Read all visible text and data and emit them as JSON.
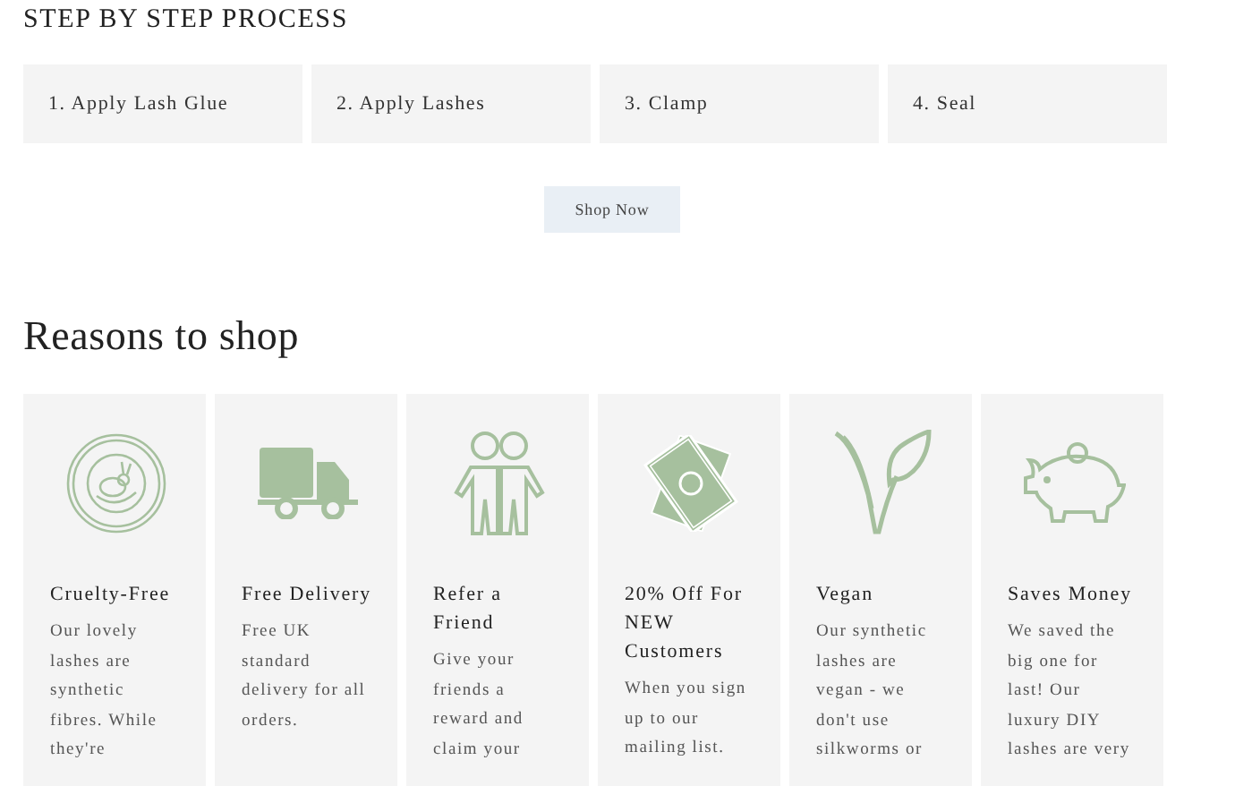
{
  "steps_section": {
    "heading": "STEP BY STEP PROCESS",
    "steps": [
      "1. Apply Lash Glue",
      "2. Apply Lashes",
      "3. Clamp",
      "4. Seal"
    ],
    "button": "Shop Now"
  },
  "reasons_section": {
    "heading": "Reasons to shop",
    "cards": [
      {
        "title_lines": [
          "Cruelty-Free"
        ],
        "body_lines": [
          "Our lovely",
          "lashes are",
          "synthetic",
          "fibres. While",
          "they're"
        ]
      },
      {
        "title_lines": [
          "Free Delivery"
        ],
        "body_lines": [
          "Free UK",
          "standard",
          "delivery for all",
          "orders."
        ]
      },
      {
        "title_lines": [
          "Refer a",
          "Friend"
        ],
        "body_lines": [
          "Give your",
          "friends a",
          "reward and",
          "claim your"
        ]
      },
      {
        "title_lines": [
          "20% Off For",
          "NEW",
          "Customers"
        ],
        "body_lines": [
          "When you sign",
          "up to our",
          "mailing list."
        ]
      },
      {
        "title_lines": [
          "Vegan"
        ],
        "body_lines": [
          "Our synthetic",
          "lashes are",
          "vegan - we",
          "don't use",
          "silkworms or"
        ]
      },
      {
        "title_lines": [
          "Saves Money"
        ],
        "body_lines": [
          "We saved the",
          "big one for",
          "last! Our",
          "luxury DIY",
          "lashes are very"
        ]
      }
    ]
  }
}
